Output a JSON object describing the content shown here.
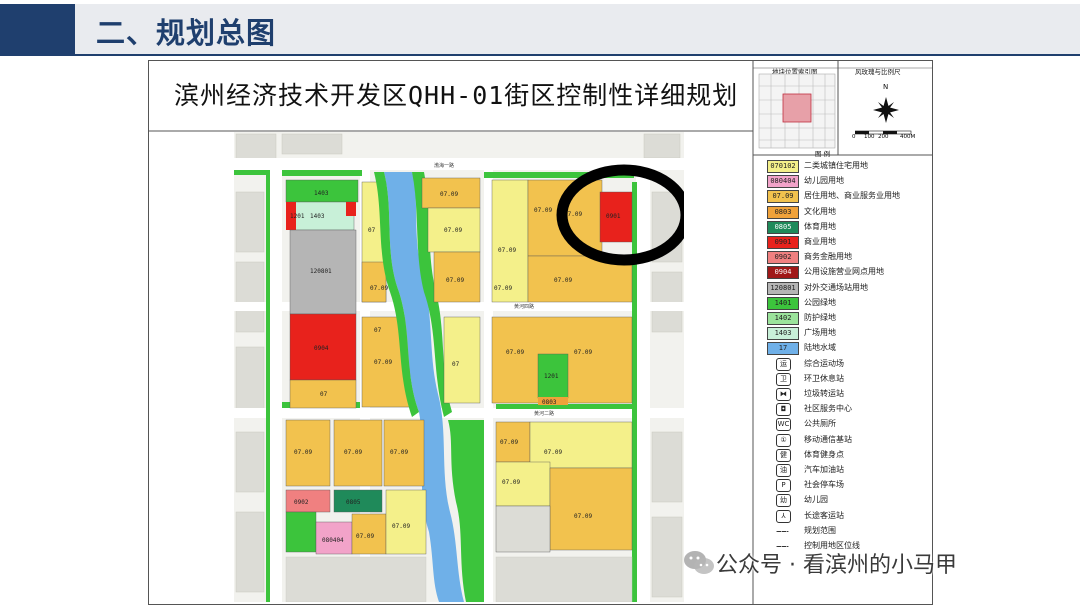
{
  "header": {
    "title": "二、规划总图"
  },
  "plan": {
    "title": "滨州经济技术开发区QHH-01街区控制性详细规划"
  },
  "insets": {
    "location_title": "地块位置索引图",
    "compass_title": "风玫瑰与比例尺",
    "north": "N",
    "scale_ticks": [
      "0",
      "100",
      "200",
      "400M"
    ],
    "legend_title": "图  例"
  },
  "map_labels": {
    "road_top": "渤海一路",
    "road_mid": "黄河四路",
    "road_low": "黄河二路",
    "blocks": [
      "1403",
      "1403",
      "1201",
      "120801",
      "0904",
      "07",
      "07",
      "07.09",
      "07.09",
      "07.09",
      "07.09",
      "07.09",
      "07.09",
      "07.09",
      "07",
      "07",
      "07.09",
      "07.09",
      "07.09",
      "07.09",
      "07.09",
      "0901",
      "1201",
      "0803",
      "07.09",
      "07.09",
      "07.09",
      "07.09",
      "07.09",
      "07.09",
      "0902",
      "0805",
      "080404",
      "07.09",
      "07.09",
      "07.09"
    ]
  },
  "legend": [
    {
      "code": "070102",
      "label": "二类城镇住宅用地",
      "color": "#f4f08a"
    },
    {
      "code": "080404",
      "label": "幼儿园用地",
      "color": "#f2a3c9"
    },
    {
      "code": "07.09",
      "label": "居住用地、商业服务业用地",
      "color": "#f2c24e"
    },
    {
      "code": "0803",
      "label": "文化用地",
      "color": "#f0a23a"
    },
    {
      "code": "0805",
      "label": "体育用地",
      "color": "#1f8a5a"
    },
    {
      "code": "0901",
      "label": "商业用地",
      "color": "#e8221c"
    },
    {
      "code": "0902",
      "label": "商务金融用地",
      "color": "#f08080"
    },
    {
      "code": "0904",
      "label": "公用设施营业网点用地",
      "color": "#a01818"
    },
    {
      "code": "120801",
      "label": "对外交通场站用地",
      "color": "#b5b5b5"
    },
    {
      "code": "1401",
      "label": "公园绿地",
      "color": "#3cc43c"
    },
    {
      "code": "1402",
      "label": "防护绿地",
      "color": "#9be39b"
    },
    {
      "code": "1403",
      "label": "广场用地",
      "color": "#c8f0d8"
    },
    {
      "code": "17",
      "label": "陆地水域",
      "color": "#6fb0e8"
    }
  ],
  "legend_symbols": [
    {
      "icon": "运",
      "label": "综合运动场"
    },
    {
      "icon": "卫",
      "label": "环卫休息站"
    },
    {
      "icon": "⧓",
      "label": "垃圾转运站"
    },
    {
      "icon": "◘",
      "label": "社区服务中心"
    },
    {
      "icon": "WC",
      "label": "公共厕所"
    },
    {
      "icon": "①",
      "label": "移动通信基站"
    },
    {
      "icon": "健",
      "label": "体育健身点"
    },
    {
      "icon": "油",
      "label": "汽车加油站"
    },
    {
      "icon": "P",
      "label": "社会停车场"
    },
    {
      "icon": "幼",
      "label": "幼儿园"
    },
    {
      "icon": "⅄",
      "label": "长途客运站"
    },
    {
      "icon": "",
      "label": "规划范围"
    },
    {
      "icon": "",
      "label": "控制用地区位线"
    }
  ],
  "watermark": {
    "text": "公众号 · 看滨州的小马甲"
  },
  "colors": {
    "header_blue": "#1f3f6e",
    "header_bar": "#e9ebef",
    "highlight_ring": "#000000"
  }
}
